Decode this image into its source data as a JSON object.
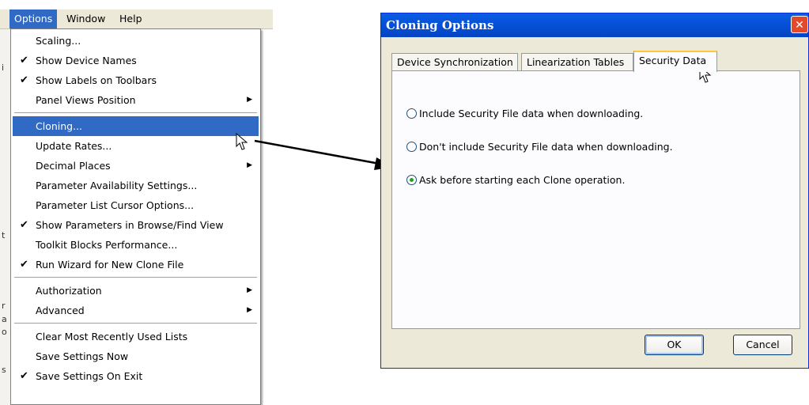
{
  "menubar": {
    "items": [
      "Options",
      "Window",
      "Help"
    ]
  },
  "options_menu": {
    "groups": [
      [
        {
          "label": "Scaling...",
          "checked": false,
          "submenu": false
        },
        {
          "label": "Show Device Names",
          "checked": true,
          "submenu": false
        },
        {
          "label": "Show Labels on Toolbars",
          "checked": true,
          "submenu": false
        },
        {
          "label": "Panel Views Position",
          "checked": false,
          "submenu": true
        }
      ],
      [
        {
          "label": "Cloning...",
          "checked": false,
          "submenu": false,
          "highlighted": true
        },
        {
          "label": "Update Rates...",
          "checked": false,
          "submenu": false
        },
        {
          "label": "Decimal Places",
          "checked": false,
          "submenu": true
        },
        {
          "label": "Parameter Availability Settings...",
          "checked": false,
          "submenu": false
        },
        {
          "label": "Parameter List Cursor Options...",
          "checked": false,
          "submenu": false
        },
        {
          "label": "Show Parameters in Browse/Find View",
          "checked": true,
          "submenu": false
        },
        {
          "label": "Toolkit Blocks Performance...",
          "checked": false,
          "submenu": false
        },
        {
          "label": "Run Wizard for New Clone File",
          "checked": true,
          "submenu": false
        }
      ],
      [
        {
          "label": "Authorization",
          "checked": false,
          "submenu": true
        },
        {
          "label": "Advanced",
          "checked": false,
          "submenu": true
        }
      ],
      [
        {
          "label": "Clear Most Recently Used Lists",
          "checked": false,
          "submenu": false
        },
        {
          "label": "Save Settings Now",
          "checked": false,
          "submenu": false
        },
        {
          "label": "Save Settings On Exit",
          "checked": true,
          "submenu": false
        }
      ]
    ]
  },
  "dialog": {
    "title": "Cloning Options",
    "close_glyph": "✕",
    "tabs": [
      "Device Synchronization",
      "Linearization Tables",
      "Security Data"
    ],
    "selected_tab": "Security Data",
    "options": [
      {
        "label": "Include Security File data when downloading.",
        "selected": false
      },
      {
        "label": "Don't include Security File data when downloading.",
        "selected": false
      },
      {
        "label": "Ask before starting each Clone operation.",
        "selected": true
      }
    ],
    "ok_label": "OK",
    "cancel_label": "Cancel"
  },
  "colors": {
    "menu_highlight": "#316ac5",
    "titlebar": "#0651d8",
    "radio_dot": "#21a121"
  },
  "icons": [
    "checkmark-icon",
    "submenu-arrow-icon",
    "close-icon",
    "mouse-pointer-icon",
    "arrow-connector"
  ]
}
